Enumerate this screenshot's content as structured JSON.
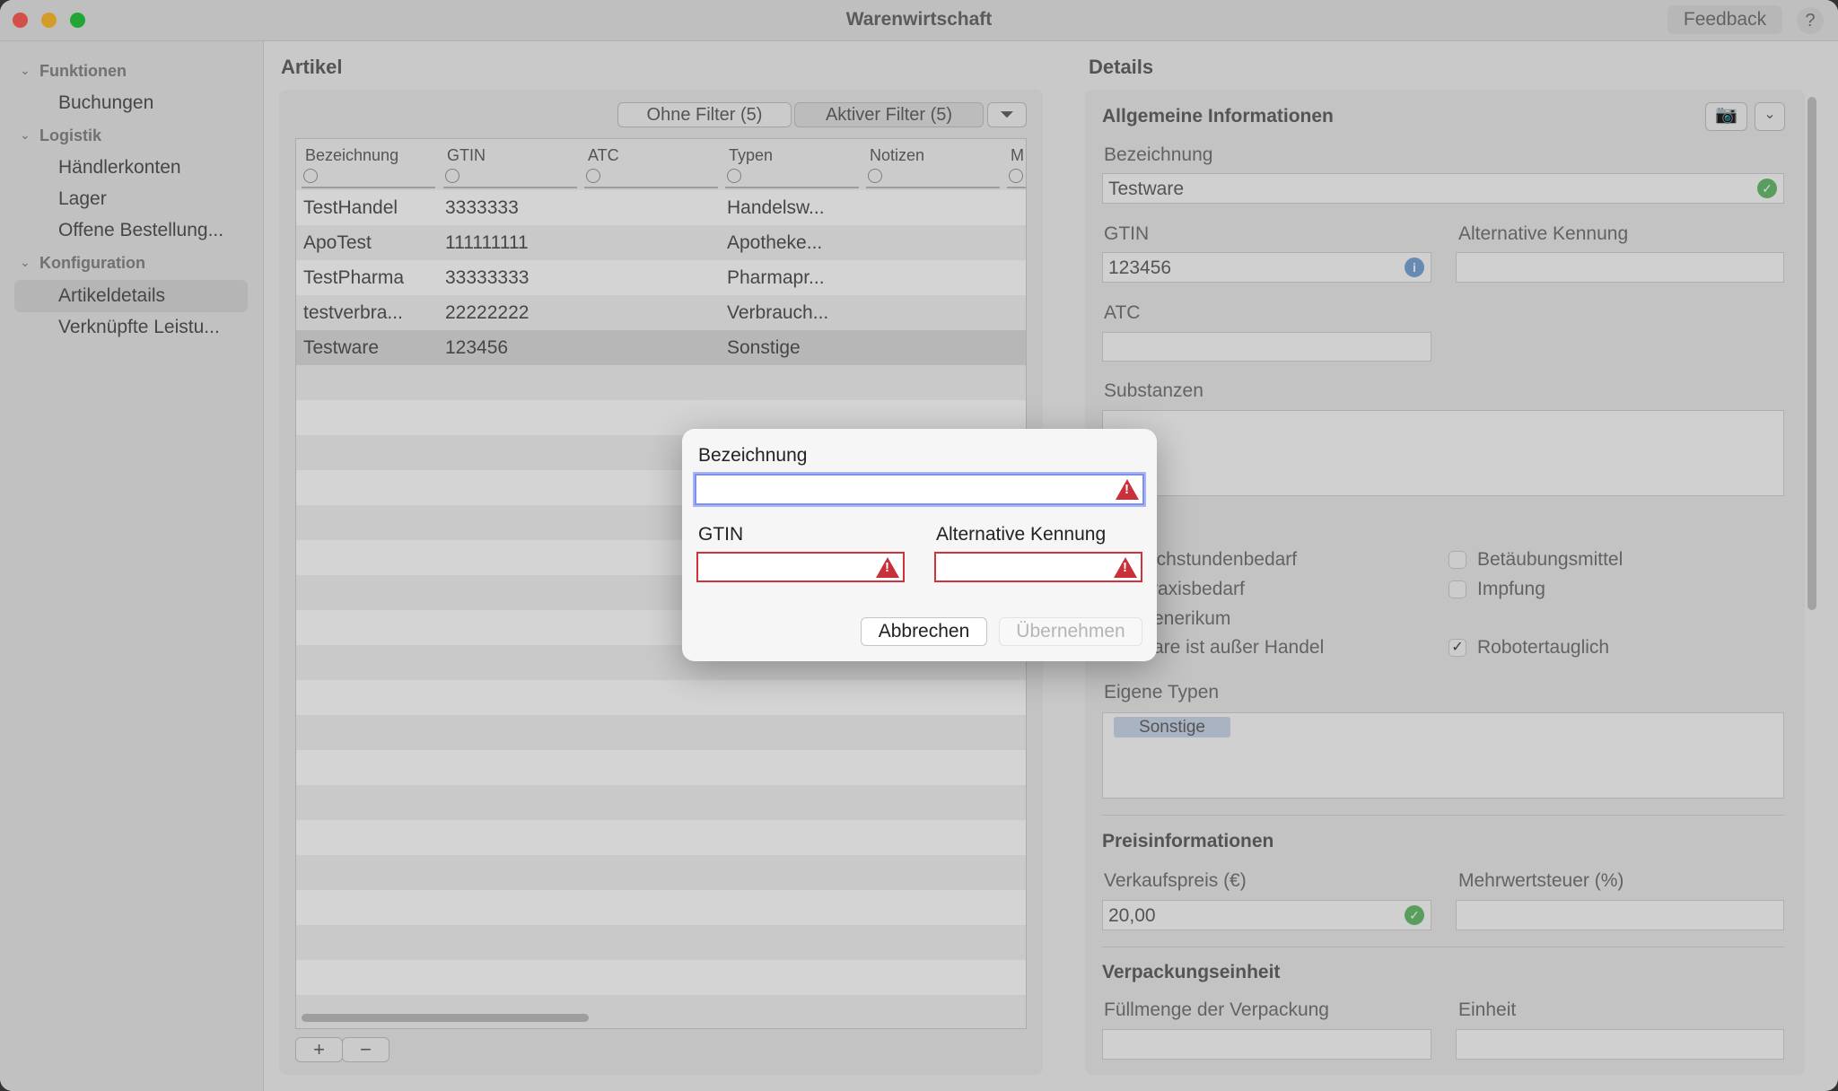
{
  "window": {
    "title": "Warenwirtschaft",
    "feedback": "Feedback",
    "help": "?"
  },
  "colors": {
    "close": "#fe5f57",
    "minimize": "#febc2e",
    "zoom": "#28c840",
    "error": "#c9303a",
    "success": "#6bbf6f",
    "focus": "#6e8cf0"
  },
  "sidebar": {
    "groups": [
      {
        "label": "Funktionen",
        "items": [
          "Buchungen"
        ]
      },
      {
        "label": "Logistik",
        "items": [
          "Händlerkonten",
          "Lager",
          "Offene Bestellung..."
        ]
      },
      {
        "label": "Konfiguration",
        "items": [
          "Artikeldetails",
          "Verknüpfte Leistu..."
        ]
      }
    ],
    "selected": "Artikeldetails"
  },
  "artikel": {
    "title": "Artikel",
    "filter_none": "Ohne Filter (5)",
    "filter_active": "Aktiver Filter (5)",
    "columns": [
      "Bezeichnung",
      "GTIN",
      "ATC",
      "Typen",
      "Notizen",
      "M"
    ],
    "rows": [
      [
        "TestHandel",
        "3333333",
        "",
        "Handelsw...",
        ""
      ],
      [
        "ApoTest",
        "111111111",
        "",
        "Apotheke...",
        ""
      ],
      [
        "TestPharma",
        "33333333",
        "",
        "Pharmapr...",
        ""
      ],
      [
        "testverbra...",
        "22222222",
        "",
        "Verbrauch...",
        ""
      ],
      [
        "Testware",
        "123456",
        "",
        "Sonstige",
        ""
      ]
    ],
    "selected_row": 4,
    "add": "+",
    "remove": "−"
  },
  "details": {
    "title": "Details",
    "section_general": "Allgemeine Informationen",
    "bezeichnung_label": "Bezeichnung",
    "bezeichnung_value": "Testware",
    "gtin_label": "GTIN",
    "gtin_value": "123456",
    "alt_label": "Alternative Kennung",
    "alt_value": "",
    "atc_label": "ATC",
    "atc_value": "",
    "substanzen_label": "Substanzen",
    "checks_left": [
      {
        "label": "rechstundenbedarf",
        "checked": false
      },
      {
        "label": "raxisbedarf",
        "checked": false
      },
      {
        "label": "enerikum",
        "checked": false
      },
      {
        "label": "are ist außer Handel",
        "checked": false
      }
    ],
    "checks_right": [
      {
        "label": "Betäubungsmittel",
        "checked": false
      },
      {
        "label": "Impfung",
        "checked": false
      },
      {
        "label": "Robotertauglich",
        "checked": true
      }
    ],
    "eigene_typen_label": "Eigene Typen",
    "eigene_typen": [
      "Sonstige"
    ],
    "section_price": "Preisinformationen",
    "vk_label": "Verkaufspreis (€)",
    "vk_value": "20,00",
    "mwst_label": "Mehrwertsteuer (%)",
    "mwst_value": "",
    "section_pack": "Verpackungseinheit",
    "fuell_label": "Füllmenge der Verpackung",
    "einheit_label": "Einheit"
  },
  "dialog": {
    "bezeichnung_label": "Bezeichnung",
    "bezeichnung_value": "",
    "gtin_label": "GTIN",
    "gtin_value": "",
    "alt_label": "Alternative Kennung",
    "alt_value": "",
    "cancel": "Abbrechen",
    "apply": "Übernehmen"
  }
}
